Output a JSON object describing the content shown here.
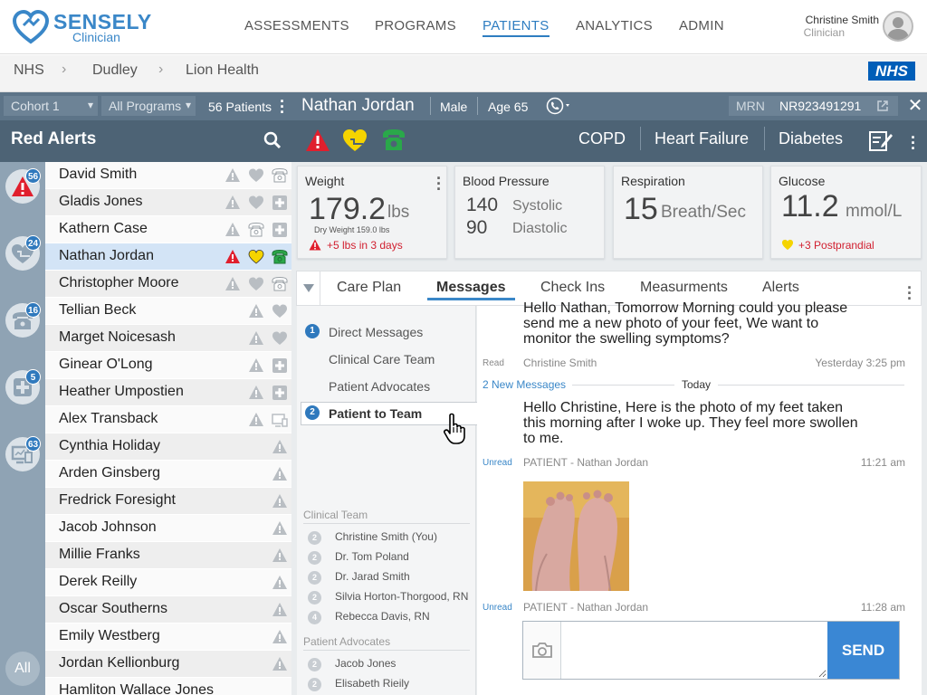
{
  "brand": {
    "name": "SENSELY",
    "sub": "Clinician"
  },
  "nav": [
    {
      "label": "ASSESSMENTS",
      "active": false
    },
    {
      "label": "PROGRAMS",
      "active": false
    },
    {
      "label": "PATIENTS",
      "active": true
    },
    {
      "label": "ANALYTICS",
      "active": false
    },
    {
      "label": "ADMIN",
      "active": false
    }
  ],
  "user": {
    "name": "Christine Smith",
    "role": "Clinician"
  },
  "breadcrumb": [
    "NHS",
    "Dudley",
    "Lion Health"
  ],
  "nhs_logo": "NHS",
  "filters": {
    "cohort": "Cohort 1",
    "programs": "All Programs",
    "patient_count": "56 Patients"
  },
  "list_title": "Red Alerts",
  "rail": [
    {
      "icon": "warning-icon",
      "count": "56",
      "active": true
    },
    {
      "icon": "heart-icon",
      "count": "24",
      "active": false
    },
    {
      "icon": "phone-icon",
      "count": "16",
      "active": false
    },
    {
      "icon": "medical-cross-icon",
      "count": "5",
      "active": false
    },
    {
      "icon": "device-icon",
      "count": "63",
      "active": false
    }
  ],
  "rail_all": "All",
  "patients": [
    {
      "name": "David Smith",
      "icons": [
        "warning",
        "heart",
        "phone"
      ],
      "alt": false
    },
    {
      "name": "Gladis Jones",
      "icons": [
        "warning",
        "heart",
        "cross"
      ],
      "alt": true
    },
    {
      "name": "Kathern Case",
      "icons": [
        "warning",
        "phone",
        "cross"
      ],
      "alt": false
    },
    {
      "name": "Nathan Jordan",
      "icons": [
        "warning-red",
        "heart-yellow",
        "phone-green"
      ],
      "alt": false,
      "selected": true
    },
    {
      "name": "Christopher Moore",
      "icons": [
        "warning",
        "heart",
        "phone"
      ],
      "alt": true
    },
    {
      "name": "Tellian Beck",
      "icons": [
        "warning",
        "heart"
      ],
      "alt": false
    },
    {
      "name": "Marget Noicesash",
      "icons": [
        "warning",
        "heart"
      ],
      "alt": true
    },
    {
      "name": "Ginear O'Long",
      "icons": [
        "warning",
        "cross"
      ],
      "alt": false
    },
    {
      "name": "Heather Umpostien",
      "icons": [
        "warning",
        "cross"
      ],
      "alt": true
    },
    {
      "name": "Alex Transback",
      "icons": [
        "warning",
        "device"
      ],
      "alt": false
    },
    {
      "name": "Cynthia Holiday",
      "icons": [
        "warning"
      ],
      "alt": true
    },
    {
      "name": "Arden Ginsberg",
      "icons": [
        "warning"
      ],
      "alt": false
    },
    {
      "name": "Fredrick Foresight",
      "icons": [
        "warning"
      ],
      "alt": true
    },
    {
      "name": "Jacob Johnson",
      "icons": [
        "warning"
      ],
      "alt": false
    },
    {
      "name": "Millie Franks",
      "icons": [
        "warning"
      ],
      "alt": true
    },
    {
      "name": "Derek Reilly",
      "icons": [
        "warning"
      ],
      "alt": false
    },
    {
      "name": "Oscar Southerns",
      "icons": [
        "warning"
      ],
      "alt": true
    },
    {
      "name": "Emily Westberg",
      "icons": [
        "warning"
      ],
      "alt": false
    },
    {
      "name": "Jordan Kellionburg",
      "icons": [
        "warning"
      ],
      "alt": true
    },
    {
      "name": "Hamliton Wallace Jones",
      "icons": [],
      "alt": false
    }
  ],
  "patient": {
    "name": "Nathan Jordan",
    "sex": "Male",
    "age": "Age 65",
    "mrn_label": "MRN",
    "mrn": "NR923491291",
    "conditions": [
      "COPD",
      "Heart Failure",
      "Diabetes"
    ]
  },
  "vitals": {
    "weight": {
      "title": "Weight",
      "value": "179.2",
      "unit": "lbs",
      "sub": "Dry Weight 159.0 lbs",
      "alert": "+5 lbs in 3 days"
    },
    "bp": {
      "title": "Blood Pressure",
      "systolic": "140",
      "systolic_label": "Systolic",
      "diastolic": "90",
      "diastolic_label": "Diastolic"
    },
    "resp": {
      "title": "Respiration",
      "value": "15",
      "unit": "Breath/Sec"
    },
    "glucose": {
      "title": "Glucose",
      "value": "11.2",
      "unit": "mmol/L",
      "alert": "+3 Postprandial"
    }
  },
  "tabs": [
    {
      "label": "Care Plan",
      "active": false
    },
    {
      "label": "Messages",
      "active": true
    },
    {
      "label": "Check Ins",
      "active": false
    },
    {
      "label": "Measurments",
      "active": false
    },
    {
      "label": "Alerts",
      "active": false
    }
  ],
  "message_categories": [
    {
      "label": "Direct Messages",
      "count": "1"
    },
    {
      "label": "Clinical Care Team",
      "count": ""
    },
    {
      "label": "Patient Advocates",
      "count": ""
    },
    {
      "label": "Patient to Team",
      "count": "2",
      "active": true
    }
  ],
  "clinical_team": {
    "title": "Clinical Team",
    "members": [
      {
        "n": "2",
        "name": "Christine Smith (You)"
      },
      {
        "n": "2",
        "name": "Dr. Tom Poland"
      },
      {
        "n": "2",
        "name": "Dr. Jarad Smith"
      },
      {
        "n": "2",
        "name": "Silvia Horton-Thorgood, RN"
      },
      {
        "n": "4",
        "name": "Rebecca Davis, RN"
      }
    ]
  },
  "patient_advocates": {
    "title": "Patient Advocates",
    "members": [
      {
        "n": "2",
        "name": "Jacob Jones"
      },
      {
        "n": "2",
        "name": "Elisabeth Rieily"
      }
    ]
  },
  "thread": {
    "msg1": {
      "lines": [
        "Hello Nathan,  Tomorrow Morning could you please",
        "send me a new photo of your feet, We want to",
        "monitor the swelling symptoms?"
      ],
      "status": "Read",
      "sender": "Christine Smith",
      "time": "Yesterday 3:25 pm"
    },
    "new_messages": "2 New Messages",
    "today": "Today",
    "msg2": {
      "lines": [
        "Hello Christine, Here is the photo of my feet taken",
        "this morning after I woke up.  They feel more swollen",
        "to me."
      ],
      "status": "Unread",
      "sender": "PATIENT - Nathan Jordan",
      "time": "11:21 am"
    },
    "msg3": {
      "status": "Unread",
      "sender": "PATIENT - Nathan Jordan",
      "time": "11:28 am"
    }
  },
  "composer": {
    "placeholder": "",
    "send": "SEND"
  },
  "colors": {
    "brand": "#3a87c8",
    "header": "#5d7488",
    "alert_red": "#e01f2d",
    "alert_yellow": "#f5d400",
    "alert_green": "#2aa84a",
    "send": "#3a87d4"
  }
}
